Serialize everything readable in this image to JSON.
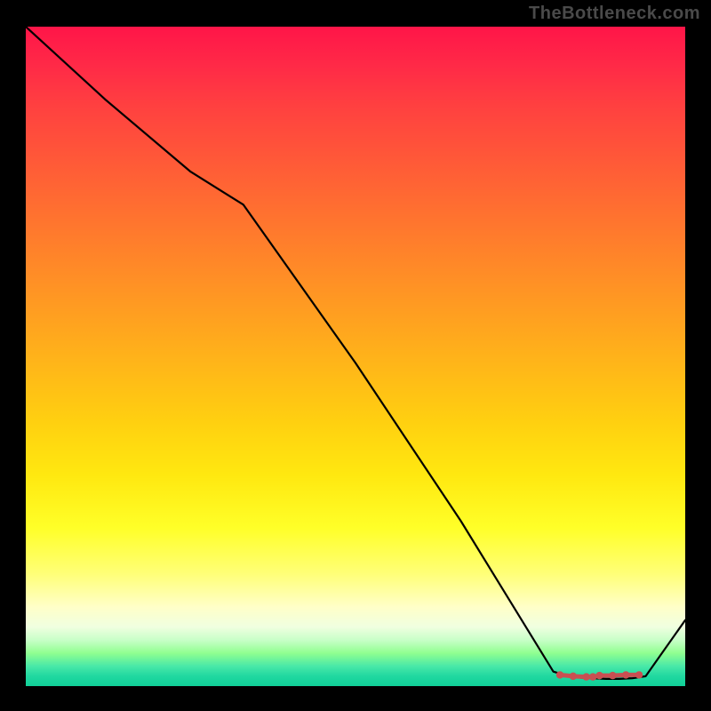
{
  "watermark": "TheBottleneck.com",
  "chart_data": {
    "type": "line",
    "title": "",
    "xlabel": "",
    "ylabel": "",
    "xlim": [
      0,
      100
    ],
    "ylim": [
      0,
      100
    ],
    "series": [
      {
        "name": "curve",
        "x": [
          0,
          12,
          25,
          33,
          50,
          66,
          80,
          82,
          84,
          86,
          88,
          90,
          92,
          94,
          100
        ],
        "values": [
          100,
          89,
          78,
          73,
          49,
          25,
          2.2,
          1.6,
          1.3,
          1.2,
          1.1,
          1.1,
          1.2,
          1.5,
          10
        ]
      }
    ],
    "markers": {
      "x": [
        81,
        83,
        85,
        86,
        87,
        89,
        91,
        93
      ],
      "values": [
        1.7,
        1.5,
        1.4,
        1.4,
        1.6,
        1.6,
        1.7,
        1.7
      ],
      "color": "#c94f52"
    },
    "gradient_stops": [
      {
        "pos": 0.0,
        "color": "#ff1548"
      },
      {
        "pos": 0.76,
        "color": "#ffff28"
      },
      {
        "pos": 1.0,
        "color": "#10d098"
      }
    ]
  }
}
